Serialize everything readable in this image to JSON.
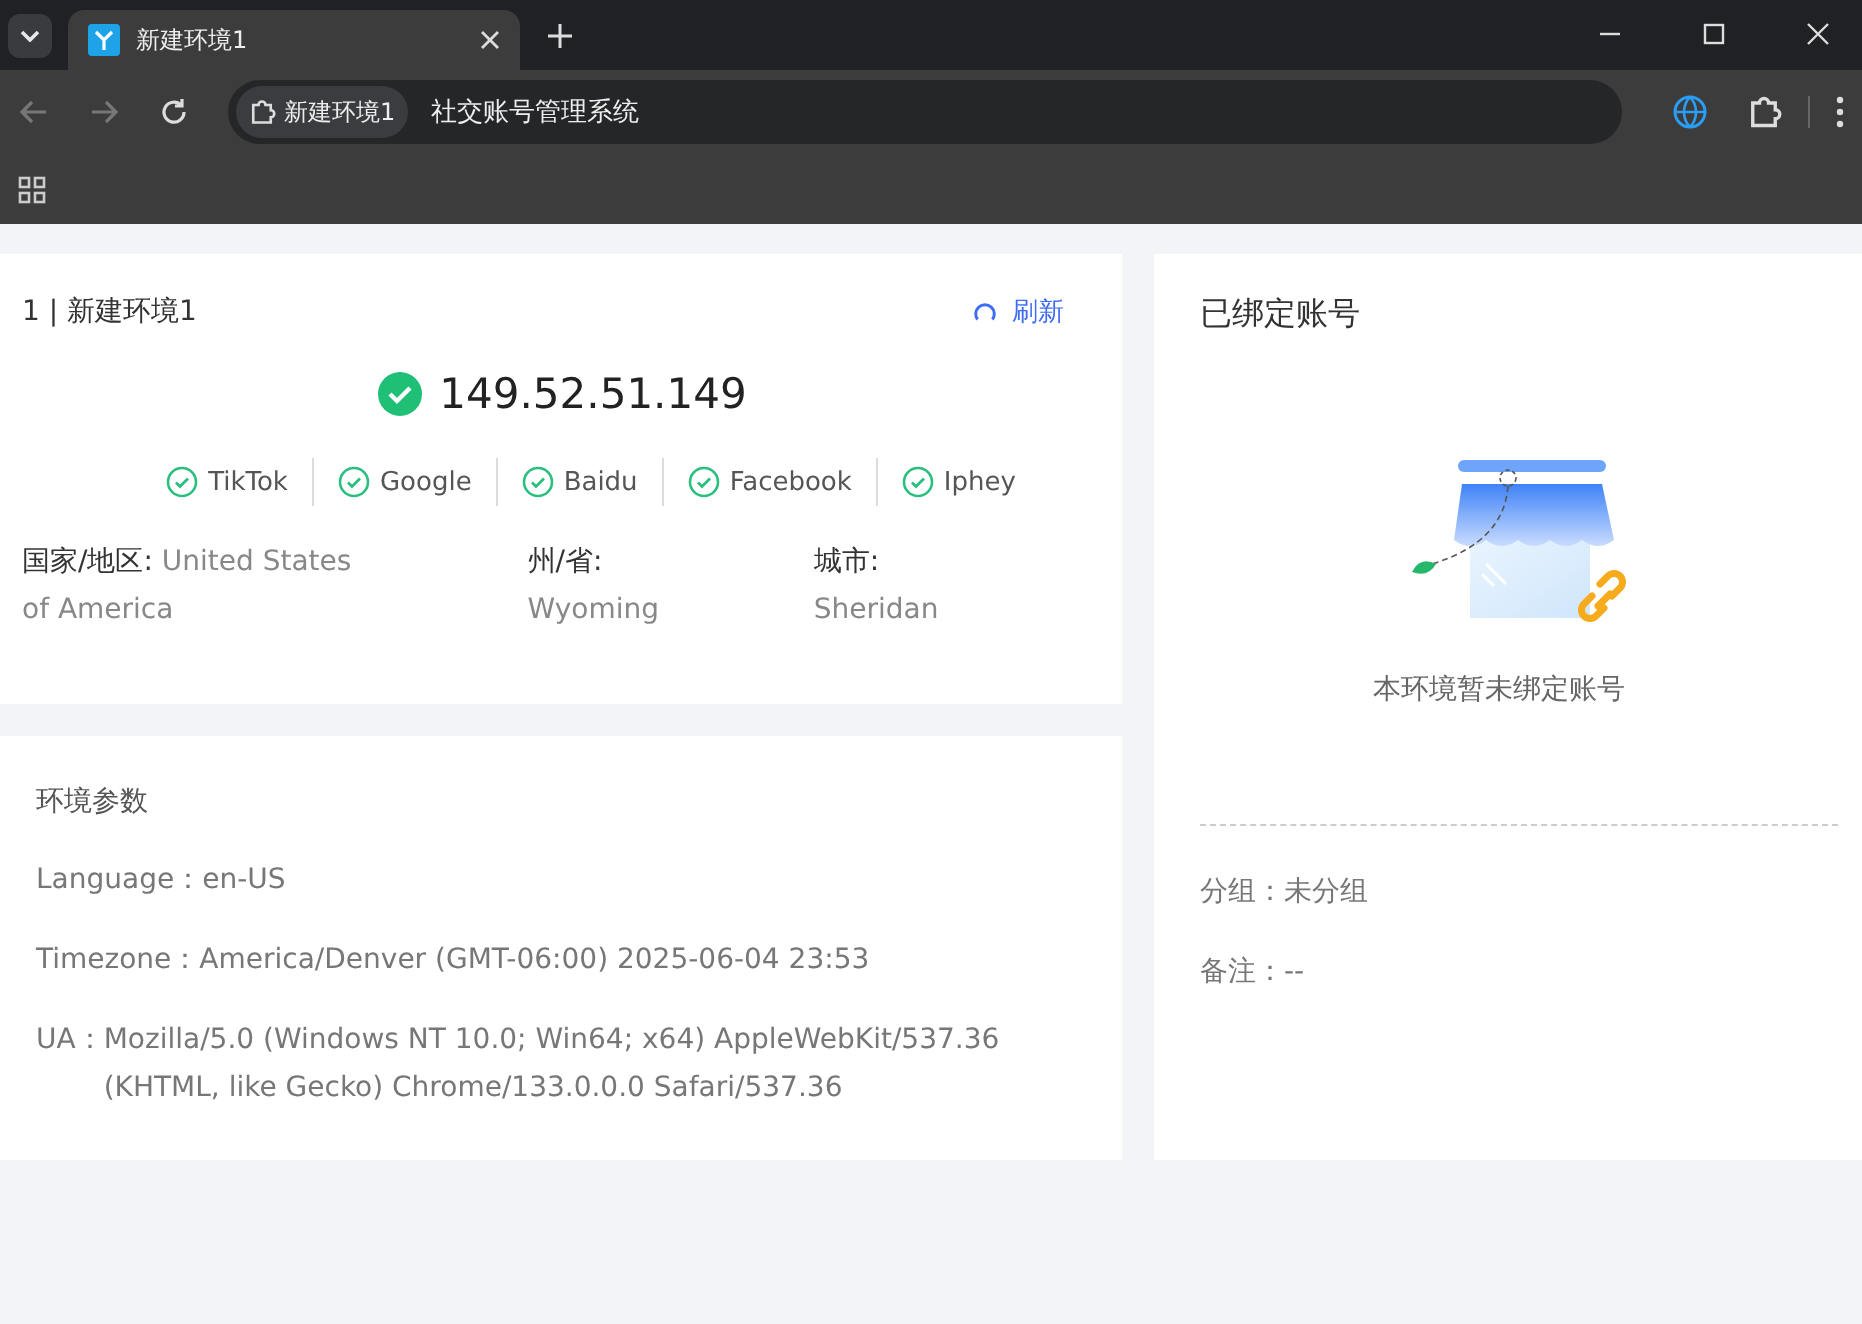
{
  "browser": {
    "tab_title": "新建环境1",
    "address_chip": "新建环境1",
    "address": "社交账号管理系统"
  },
  "ip_card": {
    "title": "1 | 新建环境1",
    "refresh": "刷新",
    "ip": "149.52.51.149",
    "ip_ok": true,
    "checks": [
      {
        "label": "TikTok",
        "passed": true
      },
      {
        "label": "Google",
        "passed": true
      },
      {
        "label": "Baidu",
        "passed": true
      },
      {
        "label": "Facebook",
        "passed": true
      },
      {
        "label": "Iphey",
        "passed": true
      }
    ],
    "location": [
      {
        "label": "国家/地区:",
        "value": "United States of America"
      },
      {
        "label": "州/省:",
        "value": "Wyoming"
      },
      {
        "label": "城市:",
        "value": "Sheridan"
      }
    ]
  },
  "env_card": {
    "title": "环境参数",
    "params": [
      {
        "label": "Language：",
        "value": "en-US"
      },
      {
        "label": "Timezone：",
        "value": "America/Denver (GMT-06:00) 2025-06-04 23:53"
      },
      {
        "label": "UA：",
        "value": "Mozilla/5.0 (Windows NT 10.0; Win64; x64) AppleWebKit/537.36 (KHTML, like Gecko) Chrome/133.0.0.0 Safari/537.36"
      }
    ]
  },
  "accounts_card": {
    "title": "已绑定账号",
    "empty_text": "本环境暂未绑定账号",
    "fields": [
      "分组：未分组",
      "备注：--"
    ]
  }
}
